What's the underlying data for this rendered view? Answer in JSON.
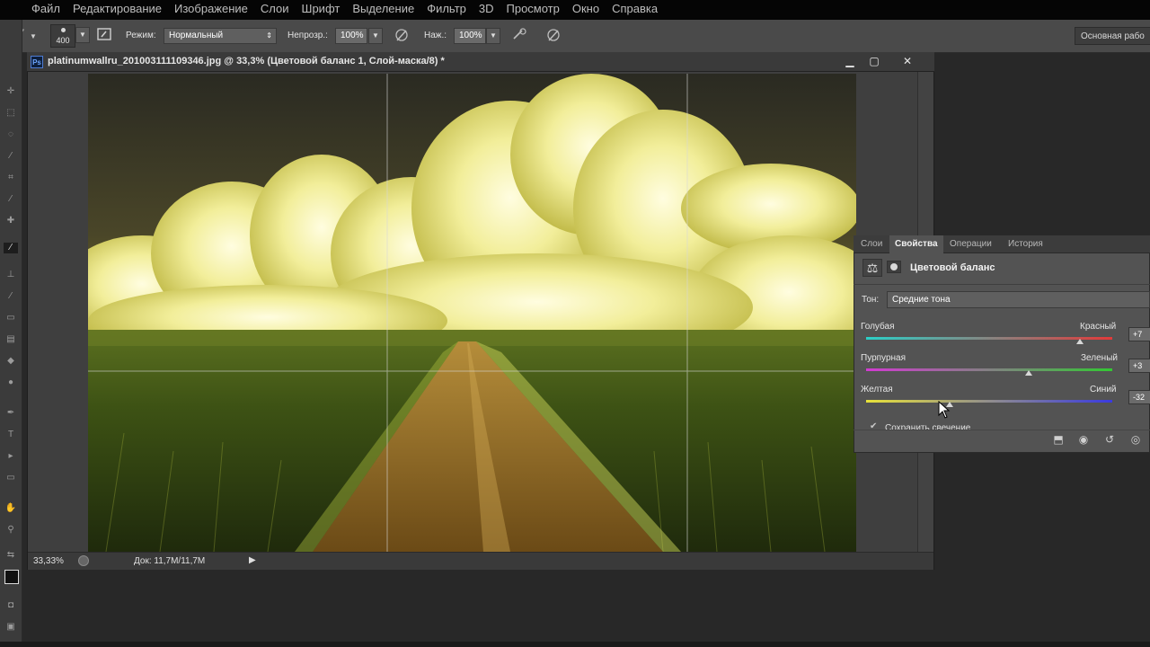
{
  "menu": [
    "Файл",
    "Редактирование",
    "Изображение",
    "Слои",
    "Шрифт",
    "Выделение",
    "Фильтр",
    "3D",
    "Просмотр",
    "Окно",
    "Справка"
  ],
  "options": {
    "brush_size": "400",
    "mode_label": "Режим:",
    "mode_value": "Нормальный",
    "opacity_label": "Непрозр.:",
    "opacity_value": "100%",
    "pressure_label": "Наж.:",
    "pressure_value": "100%",
    "workspace": "Основная рабо"
  },
  "document": {
    "ps_badge": "Ps",
    "title": "platinumwallru_201003111109346.jpg @ 33,3% (Цветовой баланс 1, Слой-маска/8) *",
    "zoom": "33,33%",
    "doc_size": "Док: 11,7M/11,7M"
  },
  "panel": {
    "tabs": [
      "Слои",
      "Свойства",
      "Операции",
      "История"
    ],
    "active_tab": 1,
    "title": "Цветовой баланс",
    "tone_label": "Тон:",
    "tone_value": "Средние тона",
    "sliders": [
      {
        "left": "Голубая",
        "right": "Красный",
        "value": "+7",
        "level": 0.87,
        "colors": [
          "#2bd0c8",
          "#e23a3a"
        ]
      },
      {
        "left": "Пурпурная",
        "right": "Зеленый",
        "value": "+3",
        "level": 0.66,
        "colors": [
          "#d23ad2",
          "#33c833"
        ]
      },
      {
        "left": "Желтая",
        "right": "Синий",
        "value": "-32",
        "level": 0.34,
        "colors": [
          "#e8e23a",
          "#3a3ae0"
        ]
      }
    ],
    "preserve_label": "Сохранить свечение",
    "preserve_checked": true
  },
  "colors": {
    "accent_ps": "#4d7bd1",
    "panel_bg": "#535353",
    "app_bg": "#282828"
  }
}
